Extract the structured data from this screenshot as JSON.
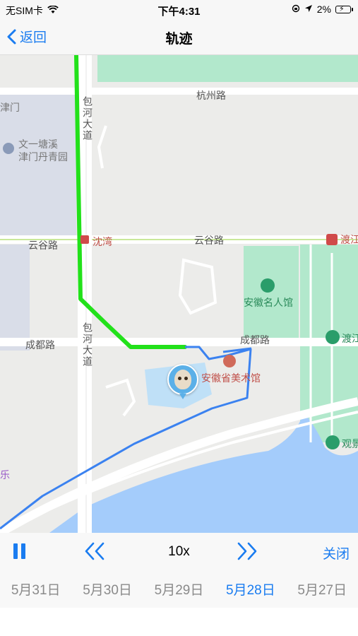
{
  "status_bar": {
    "carrier": "无SIM卡",
    "time": "下午4:31",
    "battery": "2%"
  },
  "nav": {
    "back_label": "返回",
    "title": "轨迹"
  },
  "map": {
    "roads": {
      "hangzhou": "杭州路",
      "baohe_top": "包河大道",
      "yungu_left": "云谷路",
      "yungu_right": "云谷路",
      "chengdu_left": "成都路",
      "chengdu_right": "成都路",
      "baohe_bottom": "包河大道"
    },
    "pois": {
      "jinmen": "津门",
      "wenyi_line1": "文一塘溪",
      "wenyi_line2": "津门丹青园",
      "shenwan": "沈湾",
      "dujiang": "渡江",
      "mingrenguan": "安徽名人馆",
      "dujiang2": "渡江",
      "meishuguan": "安徽省美术馆",
      "guan": "观景",
      "le": "乐"
    },
    "colors": {
      "route_green": "#22e11a",
      "route_blue": "#3b82f0",
      "water": "#a4ccfb",
      "park": "#b2e8cc"
    }
  },
  "controls": {
    "pause_icon": "pause-icon",
    "rewind_icon": "double-chevron-left-icon",
    "speed": "10x",
    "forward_icon": "double-chevron-right-icon",
    "close_label": "关闭"
  },
  "dates": [
    {
      "label": "5月31日",
      "active": false
    },
    {
      "label": "5月30日",
      "active": false
    },
    {
      "label": "5月29日",
      "active": false
    },
    {
      "label": "5月28日",
      "active": true
    },
    {
      "label": "5月27日",
      "active": false
    }
  ]
}
